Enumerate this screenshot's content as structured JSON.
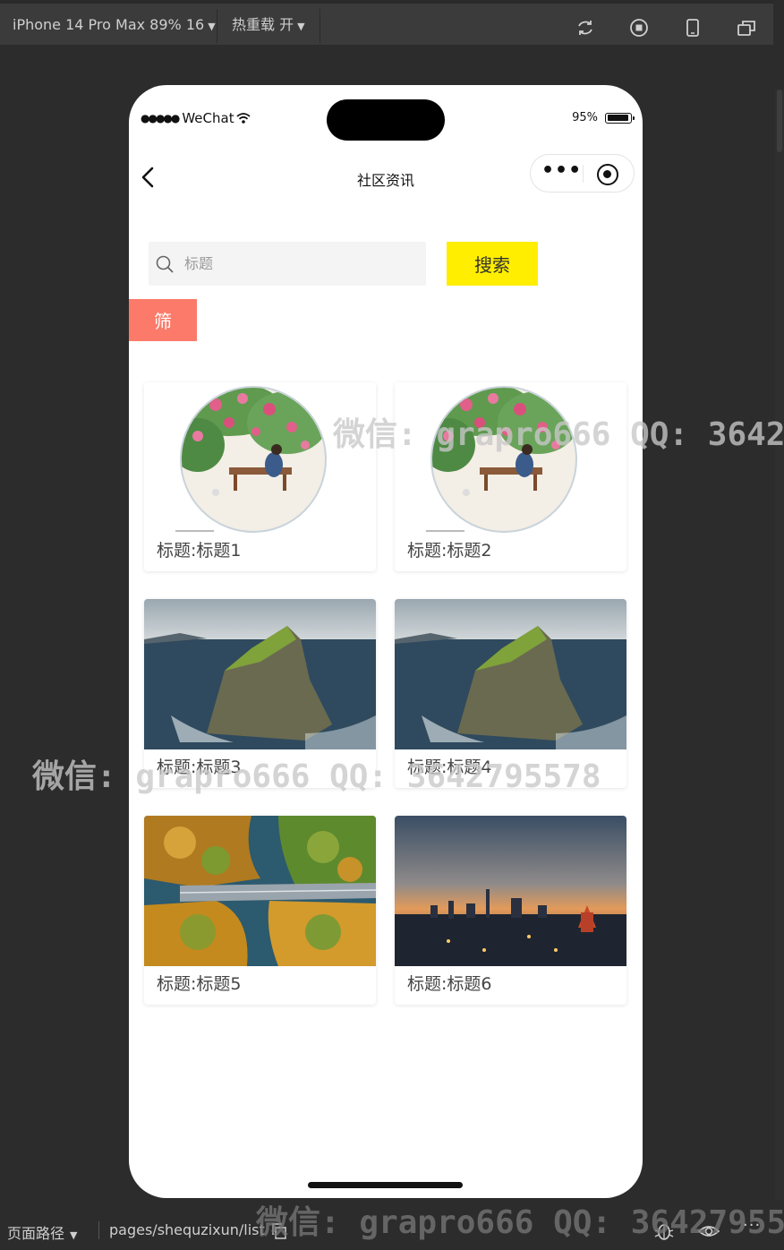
{
  "toolbar": {
    "device_label": "iPhone 14 Pro Max 89% 16",
    "hot_reload_label": "热重载 开"
  },
  "status_bar": {
    "carrier": "WeChat",
    "battery": "95%",
    "battery_level": 0.95
  },
  "nav": {
    "title": "社区资讯"
  },
  "search": {
    "placeholder": "标题",
    "value": "",
    "button_label": "搜索"
  },
  "filter": {
    "label": "筛"
  },
  "cards": [
    {
      "title": "标题:标题1",
      "image": "flower-swing-illustration"
    },
    {
      "title": "标题:标题2",
      "image": "flower-swing-illustration"
    },
    {
      "title": "标题:标题3",
      "image": "sea-cliff-island"
    },
    {
      "title": "标题:标题4",
      "image": "sea-cliff-island"
    },
    {
      "title": "标题:标题5",
      "image": "autumn-forest-bridge"
    },
    {
      "title": "标题:标题6",
      "image": "city-sunset-skyline"
    }
  ],
  "bottom_bar": {
    "path_label": "页面路径",
    "path": "pages/shequzixun/list"
  },
  "watermarks": [
    "微信: grapro666 QQ: 3642",
    "微信: grapro666 QQ: 3642795578",
    "微信: grapro666 QQ: 36427955"
  ],
  "colors": {
    "search_button": "#ffee00",
    "filter_button": "#fb7a6a",
    "page_background": "#ffffff",
    "devtools_background": "#2c2c2c"
  }
}
